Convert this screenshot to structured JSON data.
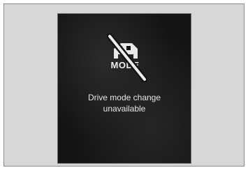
{
  "display": {
    "icon_name": "drive-mode-unavailable-icon",
    "icon_label": "MODE",
    "message_line1": "Drive mode change",
    "message_line2": "unavailable"
  },
  "colors": {
    "screen_background": "#141414",
    "text": "#e6e6e6",
    "frame_background": "#d7d7d7"
  }
}
